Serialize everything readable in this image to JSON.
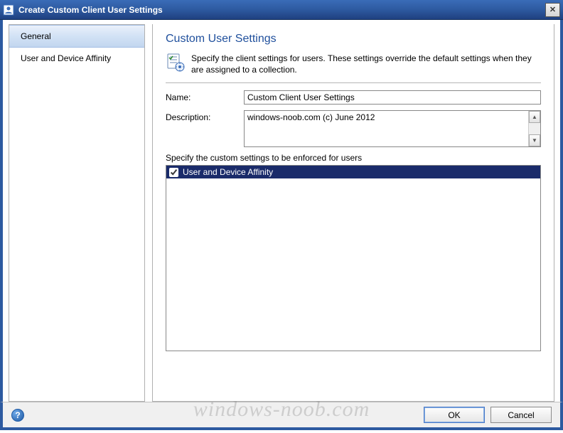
{
  "window": {
    "title": "Create Custom Client User Settings"
  },
  "sidebar": {
    "items": [
      {
        "label": "General",
        "selected": true
      },
      {
        "label": "User and Device Affinity",
        "selected": false
      }
    ]
  },
  "main": {
    "heading": "Custom User Settings",
    "intro": "Specify the client settings for users. These settings override the default settings when they are assigned to a collection.",
    "name_label": "Name:",
    "name_value": "Custom Client User Settings",
    "description_label": "Description:",
    "description_value": "windows-noob.com (c) June 2012",
    "enforce_label": "Specify the custom settings to be enforced for users",
    "settings": [
      {
        "label": "User and Device Affinity",
        "checked": true,
        "selected": true
      }
    ]
  },
  "footer": {
    "ok_label": "OK",
    "cancel_label": "Cancel",
    "help_symbol": "?"
  },
  "watermark": "windows-noob.com"
}
